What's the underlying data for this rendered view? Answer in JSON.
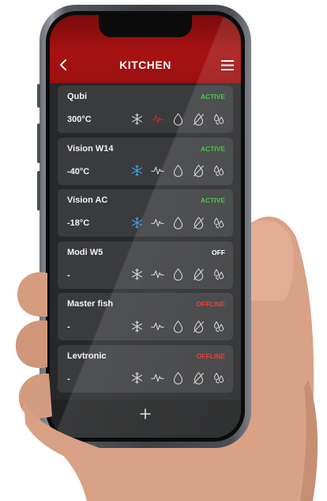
{
  "header": {
    "title": "KITCHEN",
    "back_icon": "chevron-left-icon",
    "menu_icon": "hamburger-menu-icon"
  },
  "colors": {
    "active": "#3bbf3b",
    "off": "#ffffff",
    "offline": "#e23030",
    "icon_default": "#cfcfcf",
    "icon_snow_active": "#3aa0e8",
    "icon_wave_active": "#d22a2a"
  },
  "icon_set": [
    "snowflake-icon",
    "wave-icon",
    "drop-icon",
    "drop-off-icon",
    "dry-icon"
  ],
  "devices": [
    {
      "name": "Qubi",
      "status": "ACTIVE",
      "status_kind": "active",
      "temp": "300°C",
      "active_icon": "wave"
    },
    {
      "name": "Vision W14",
      "status": "ACTIVE",
      "status_kind": "active",
      "temp": "-40°C",
      "active_icon": "snow"
    },
    {
      "name": "Vision AC",
      "status": "ACTIVE",
      "status_kind": "active",
      "temp": "-18°C",
      "active_icon": "snow"
    },
    {
      "name": "Modi W5",
      "status": "OFF",
      "status_kind": "off",
      "temp": "-",
      "active_icon": ""
    },
    {
      "name": "Master fish",
      "status": "OFFLINE",
      "status_kind": "offline",
      "temp": "-",
      "active_icon": ""
    },
    {
      "name": "Levtronic",
      "status": "OFFLINE",
      "status_kind": "offline",
      "temp": "-",
      "active_icon": ""
    }
  ],
  "bottom_bar": {
    "add_icon": "plus-icon"
  }
}
